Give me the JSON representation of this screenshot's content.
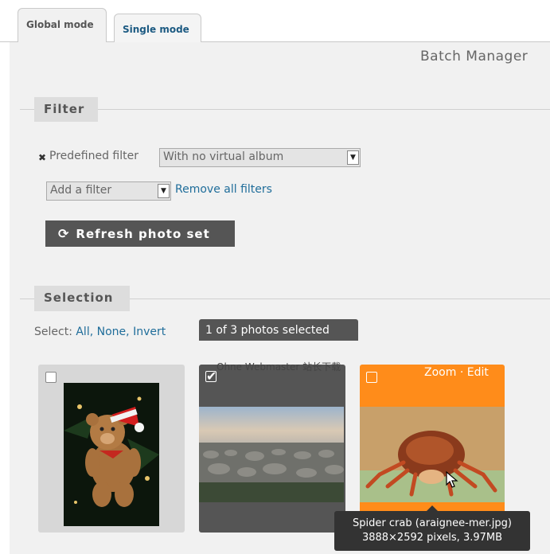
{
  "tabs": [
    {
      "label": "Global mode",
      "active": true
    },
    {
      "label": "Single mode",
      "active": false
    }
  ],
  "page_title": "Batch Manager",
  "filter": {
    "heading": "Filter",
    "predefined_label": "Predefined filter",
    "predefined_value": "With no virtual album",
    "add_filter_placeholder": "Add a filter",
    "remove_all_label": "Remove all filters",
    "refresh_label": "Refresh photo set"
  },
  "selection": {
    "heading": "Selection",
    "select_label": "Select:",
    "options": [
      "All,",
      "None,",
      "Invert"
    ],
    "count_text": "1 of 3 photos selected"
  },
  "watermark_text": "Ohne Webmaster 站长下载",
  "thumbnails": [
    {
      "name": "teddy-bear",
      "checked": false,
      "selected": false
    },
    {
      "name": "rocky-shore",
      "checked": true,
      "selected": false
    },
    {
      "name": "spider-crab",
      "checked": false,
      "selected": true
    }
  ],
  "thumb_actions": {
    "zoom": "Zoom",
    "separator": "·",
    "edit": "Edit"
  },
  "tooltip": {
    "line1": "Spider crab (araignee-mer.jpg)",
    "line2": "3888×2592 pixels, 3.97MB"
  },
  "colors": {
    "accent_orange": "#ff8c1a",
    "link_blue": "#1f6d9a",
    "button_dark": "#555555",
    "panel_bg": "#f1f1f1"
  }
}
